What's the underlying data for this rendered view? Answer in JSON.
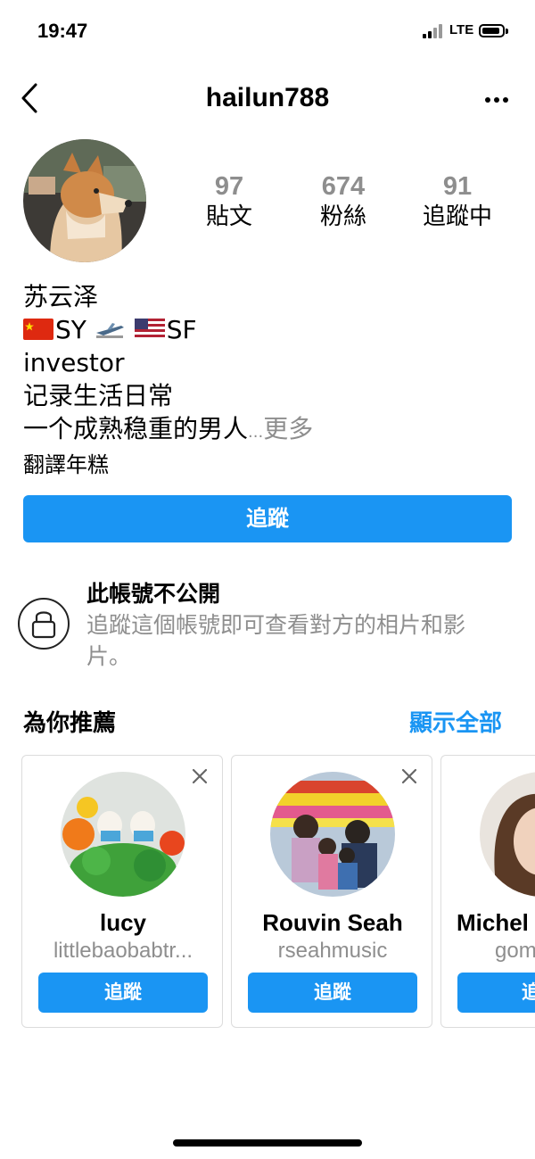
{
  "status_bar": {
    "time": "19:47",
    "network": "LTE"
  },
  "header": {
    "username": "hailun788"
  },
  "stats": [
    {
      "value": "97",
      "label": "貼文"
    },
    {
      "value": "674",
      "label": "粉絲"
    },
    {
      "value": "91",
      "label": "追蹤中"
    }
  ],
  "bio": {
    "name": "苏云泽",
    "route_from": "SY",
    "route_to": "SF",
    "line_occupation": "investor",
    "line_1": "记录生活日常",
    "line_2": "一个成熟稳重的男人",
    "ellipsis": "...",
    "more": "更多",
    "translate": "翻譯年糕"
  },
  "follow_button": "追蹤",
  "private_notice": {
    "title": "此帳號不公開",
    "description": "追蹤這個帳號即可查看對方的相片和影片。"
  },
  "suggestions": {
    "title": "為你推薦",
    "see_all": "顯示全部",
    "cards": [
      {
        "name": "lucy",
        "handle": "littlebaobabtr...",
        "button": "追蹤"
      },
      {
        "name": "Rouvin Seah",
        "handle": "rseahmusic",
        "button": "追蹤"
      },
      {
        "name": "Michel",
        "handle": "gom",
        "button": "追"
      }
    ]
  },
  "icons": [
    "back-chevron-icon",
    "more-options-icon",
    "lock-icon",
    "close-icon"
  ],
  "colors": {
    "accent": "#1a95f3",
    "secondary_text": "#8e8e8e"
  }
}
